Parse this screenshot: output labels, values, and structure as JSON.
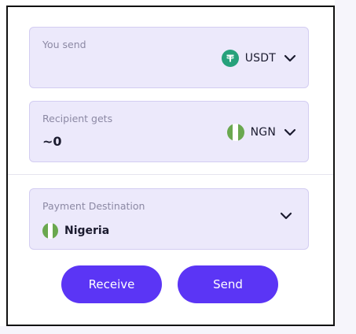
{
  "send": {
    "label": "You send",
    "currency_code": "USDT",
    "currency_icon": "tether-icon",
    "currency_icon_color": "#26a17b"
  },
  "receive": {
    "label": "Recipient gets",
    "amount": "~0",
    "currency_code": "NGN",
    "currency_icon": "nigeria-flag-icon"
  },
  "destination": {
    "label": "Payment Destination",
    "country": "Nigeria",
    "country_icon": "nigeria-flag-icon"
  },
  "actions": {
    "receive_label": "Receive",
    "send_label": "Send"
  },
  "colors": {
    "accent": "#5b35f5",
    "field_bg": "#ece9fb",
    "flag_green": "#6aa84f"
  }
}
